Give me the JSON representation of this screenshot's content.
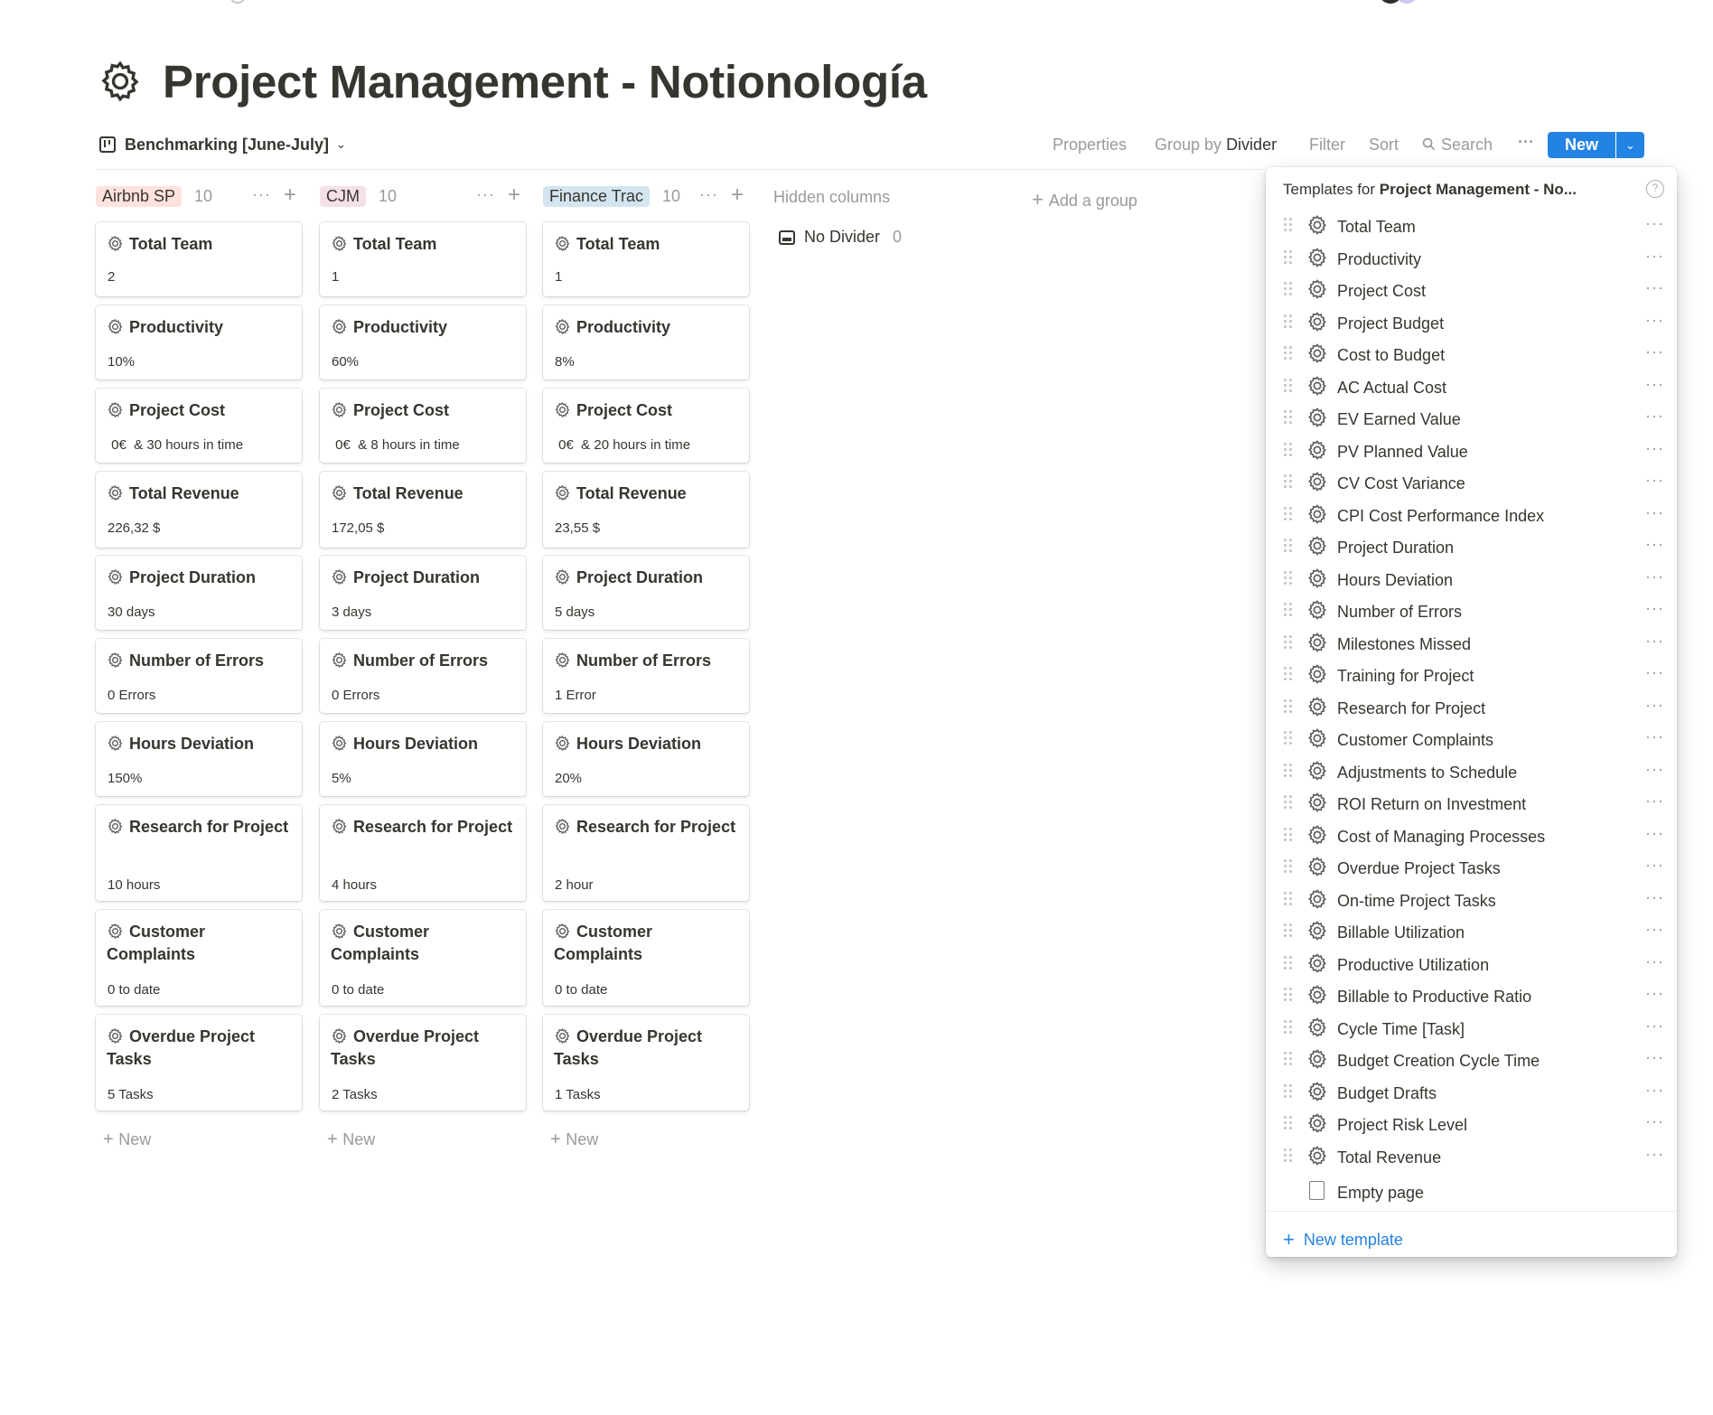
{
  "page": {
    "title": "Project Management - Notionología",
    "icon": "gear-icon"
  },
  "view": {
    "name": "Benchmarking [June-July]",
    "icon": "board-icon"
  },
  "toolbar": {
    "properties": "Properties",
    "group_by_prefix": "Group by",
    "group_by_value": "Divider",
    "filter": "Filter",
    "sort": "Sort",
    "search": "Search",
    "more": "···",
    "new_label": "New",
    "new_caret": "⌄"
  },
  "colors": {
    "accent": "#2383e2",
    "text": "#37352f",
    "muted": "#9b9a97",
    "tag_airbnb": "#ffe2dd",
    "tag_cjm": "#f5e0e9",
    "tag_finance": "#d3e5ef"
  },
  "board": {
    "columns": [
      {
        "tag": "Airbnb SP",
        "count": "10",
        "tag_color": "#ffe2dd",
        "new_label": "New",
        "cards": [
          {
            "title": "Total Team",
            "value": "2"
          },
          {
            "title": "Productivity",
            "value": "10%"
          },
          {
            "title": "Project Cost",
            "value": " 0€  & 30 hours in time"
          },
          {
            "title": "Total Revenue",
            "value": "226,32 $"
          },
          {
            "title": "Project Duration",
            "value": "30 days"
          },
          {
            "title": "Number of Errors",
            "value": "0 Errors"
          },
          {
            "title": "Hours Deviation",
            "value": "150%"
          },
          {
            "title": "Research for Project",
            "value": "10 hours"
          },
          {
            "title": "Customer Complaints",
            "value": "0 to date"
          },
          {
            "title": "Overdue Project Tasks",
            "value": "5 Tasks"
          }
        ]
      },
      {
        "tag": "CJM",
        "count": "10",
        "tag_color": "#f5e0e9",
        "new_label": "New",
        "cards": [
          {
            "title": "Total Team",
            "value": "1"
          },
          {
            "title": "Productivity",
            "value": "60%"
          },
          {
            "title": "Project Cost",
            "value": " 0€  & 8 hours in time"
          },
          {
            "title": "Total Revenue",
            "value": "172,05 $"
          },
          {
            "title": "Project Duration",
            "value": "3 days"
          },
          {
            "title": "Number of Errors",
            "value": "0 Errors"
          },
          {
            "title": "Hours Deviation",
            "value": "5%"
          },
          {
            "title": "Research for Project",
            "value": "4 hours"
          },
          {
            "title": "Customer Complaints",
            "value": "0 to date"
          },
          {
            "title": "Overdue Project Tasks",
            "value": "2 Tasks"
          }
        ]
      },
      {
        "tag": "Finance Trac",
        "count": "10",
        "tag_color": "#d3e5ef",
        "new_label": "New",
        "cards": [
          {
            "title": "Total Team",
            "value": "1"
          },
          {
            "title": "Productivity",
            "value": "8%"
          },
          {
            "title": "Project Cost",
            "value": " 0€  & 20 hours in time"
          },
          {
            "title": "Total Revenue",
            "value": "23,55 $"
          },
          {
            "title": "Project Duration",
            "value": "5 days"
          },
          {
            "title": "Number of Errors",
            "value": "1 Error"
          },
          {
            "title": "Hours Deviation",
            "value": "20%"
          },
          {
            "title": "Research for Project",
            "value": "2 hour"
          },
          {
            "title": "Customer Complaints",
            "value": "0 to date"
          },
          {
            "title": "Overdue Project Tasks",
            "value": "1 Tasks"
          }
        ]
      }
    ],
    "hidden_columns_label": "Hidden columns",
    "add_group_label": "Add a group",
    "no_divider_label": "No Divider",
    "no_divider_count": "0"
  },
  "templates": {
    "header_prefix": "Templates for",
    "header_db": "Project Management - No...",
    "help": "?",
    "items": [
      "Total Team",
      "Productivity",
      "Project Cost",
      "Project Budget",
      "Cost to Budget",
      "AC Actual Cost",
      "EV Earned Value",
      "PV Planned Value",
      "CV Cost Variance",
      "CPI Cost Performance Index",
      "Project Duration",
      "Hours Deviation",
      "Number of Errors",
      "Milestones Missed",
      "Training for Project",
      "Research for Project",
      "Customer Complaints",
      "Adjustments to Schedule",
      "ROI Return on Investment",
      "Cost of Managing Processes",
      "Overdue Project Tasks",
      "On-time Project Tasks",
      "Billable Utilization",
      "Productive Utilization",
      "Billable to Productive Ratio",
      "Cycle Time [Task]",
      "Budget Creation Cycle Time",
      "Budget Drafts",
      "Project Risk Level",
      "Total Revenue"
    ],
    "empty_page_label": "Empty page",
    "new_template_label": "New template"
  }
}
